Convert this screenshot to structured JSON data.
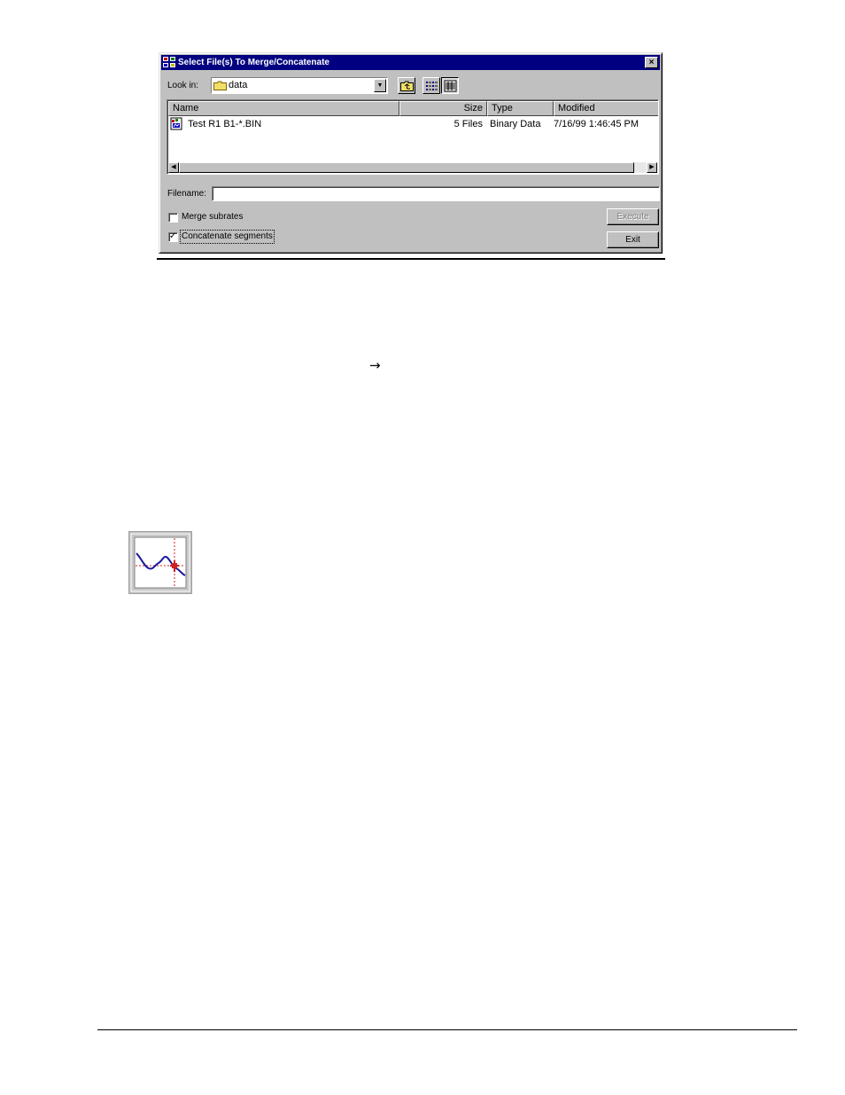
{
  "dialog": {
    "title": "Select File(s) To Merge/Concatenate",
    "close_label": "×",
    "look_in_label": "Look in:",
    "look_in_value": "data",
    "combo_arrow": "▼",
    "columns": [
      "Name",
      "Size",
      "Type",
      "Modified"
    ],
    "rows": [
      {
        "name": "Test R1 B1-*.BIN",
        "size": "5 Files",
        "type": "Binary Data",
        "modified": "7/16/99 1:46:45 PM"
      }
    ],
    "scroll_left": "◀",
    "scroll_right": "▶",
    "filename_label": "Filename:",
    "filename_value": "",
    "merge_label": "Merge subrates",
    "merge_checked": false,
    "concat_label": "Concatenate segments",
    "concat_checked": true,
    "check_mark": "✓",
    "execute_label": "Execute",
    "exit_label": "Exit"
  },
  "doc": {
    "arrow_glyph": "→"
  },
  "colors": {
    "titlebar": "#000080",
    "face": "#c0c0c0",
    "plot_line": "#1a1aa0",
    "cursor_line": "#d02020"
  },
  "icons": [
    "app-icon",
    "folder-icon",
    "up-folder-icon",
    "list-view-icon",
    "details-view-icon",
    "file-icon",
    "cursor-plot-icon"
  ]
}
